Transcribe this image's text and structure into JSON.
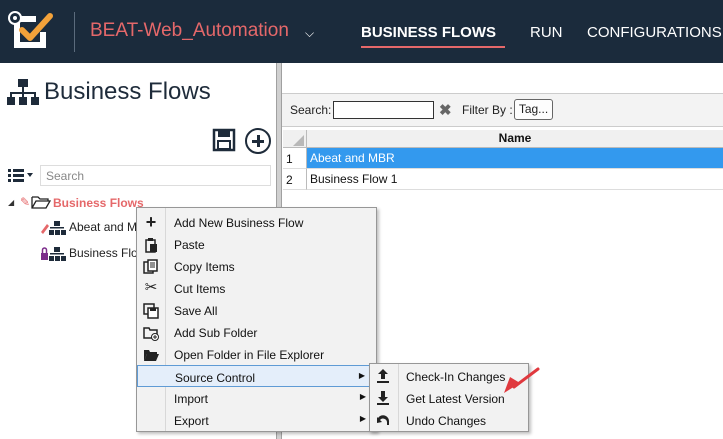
{
  "topbar": {
    "app_title": "BEAT-Web_Automation",
    "nav": [
      {
        "label": "BUSINESS FLOWS",
        "active": true
      },
      {
        "label": "RUN",
        "active": false
      },
      {
        "label": "CONFIGURATIONS",
        "active": false
      }
    ],
    "accent": "#e5686a",
    "bg": "#1b2b3c"
  },
  "left_pane": {
    "title": "Business Flows",
    "search_placeholder": "Search",
    "tree": {
      "root_label": "Business Flows",
      "children": [
        {
          "label": "Abeat and M",
          "icon": "flow-icon-edit"
        },
        {
          "label": "Business Flo",
          "icon": "flow-icon-locked"
        }
      ]
    }
  },
  "grid": {
    "search_label": "Search:",
    "filter_label": "Filter By :",
    "tag_button": "Tag...",
    "column_header": "Name",
    "rows": [
      {
        "num": "1",
        "name": "Abeat and MBR",
        "selected": true
      },
      {
        "num": "2",
        "name": "Business Flow 1",
        "selected": false
      }
    ]
  },
  "context_menu": {
    "items": [
      {
        "label": "Add New Business Flow",
        "icon": "plus-icon"
      },
      {
        "label": "Paste",
        "icon": "paste-icon"
      },
      {
        "label": "Copy Items",
        "icon": "copy-icon"
      },
      {
        "label": "Cut Items",
        "icon": "cut-icon"
      },
      {
        "label": "Save All",
        "icon": "save-all-icon"
      },
      {
        "label": "Add Sub Folder",
        "icon": "add-folder-icon"
      },
      {
        "label": "Open Folder in File Explorer",
        "icon": "open-folder-icon"
      },
      {
        "label": "Source Control",
        "icon": "",
        "submenu": true
      },
      {
        "label": "Import",
        "icon": "",
        "submenu": true
      },
      {
        "label": "Export",
        "icon": "",
        "submenu": true
      }
    ]
  },
  "source_control_submenu": {
    "items": [
      {
        "label": "Check-In Changes",
        "icon": "upload-icon"
      },
      {
        "label": "Get Latest Version",
        "icon": "download-icon"
      },
      {
        "label": "Undo Changes",
        "icon": "undo-icon"
      }
    ]
  }
}
